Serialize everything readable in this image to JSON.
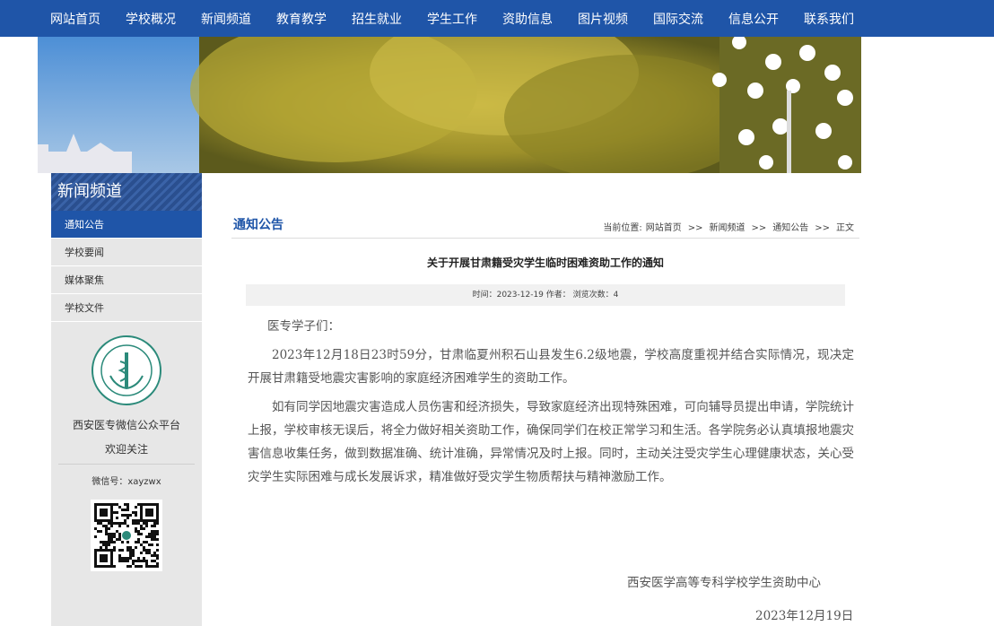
{
  "nav": {
    "items": [
      "网站首页",
      "学校概况",
      "新闻频道",
      "教育教学",
      "招生就业",
      "学生工作",
      "资助信息",
      "图片视频",
      "国际交流",
      "信息公开",
      "联系我们"
    ]
  },
  "sidebar": {
    "title": "新闻频道",
    "items": [
      {
        "label": "通知公告",
        "active": true
      },
      {
        "label": "学校要闻",
        "active": false
      },
      {
        "label": "媒体聚焦",
        "active": false
      },
      {
        "label": "学校文件",
        "active": false
      }
    ],
    "wechat_title": "西安医专微信公众平台",
    "welcome": "欢迎关注",
    "wechat_id": "微信号：xayzwx"
  },
  "main": {
    "category": "通知公告",
    "breadcrumb": {
      "prefix": "当前位置:",
      "items": [
        "网站首页",
        "新闻频道",
        "通知公告",
        "正文"
      ],
      "separator": ">>"
    },
    "title": "关于开展甘肃籍受灾学生临时困难资助工作的通知",
    "meta": "时间：2023-12-19 作者：  浏览次数：4",
    "greeting": "医专学子们：",
    "paragraphs": [
      "2023年12月18日23时59分，甘肃临夏州积石山县发生6.2级地震，学校高度重视并结合实际情况，现决定开展甘肃籍受地震灾害影响的家庭经济困难学生的资助工作。",
      "如有同学因地震灾害造成人员伤害和经济损失，导致家庭经济出现特殊困难，可向辅导员提出申请，学院统计上报，学校审核无误后，将全力做好相关资助工作，确保同学们在校正常学习和生活。各学院务必认真填报地震灾害信息收集任务，做到数据准确、统计准确，异常情况及时上报。同时，主动关注受灾学生心理健康状态，关心受灾学生实际困难与成长发展诉求，精准做好受灾学生物质帮扶与精神激励工作。"
    ],
    "signature": "西安医学高等专科学校学生资助中心",
    "date": "2023年12月19日"
  },
  "colors": {
    "brand": "#1f55a8",
    "sidebar_bg": "#e7e7e7"
  }
}
